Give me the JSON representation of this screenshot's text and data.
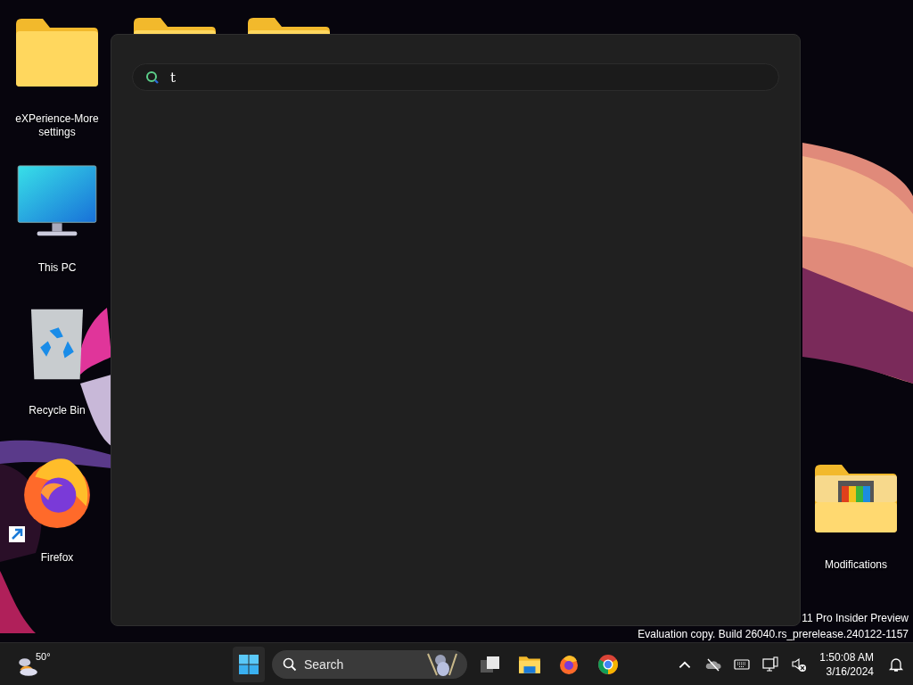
{
  "desktop": {
    "icons": [
      {
        "kind": "folder",
        "label": "eXPerience-More settings"
      },
      {
        "kind": "pc",
        "label": "This PC"
      },
      {
        "kind": "bin",
        "label": "Recycle Bin"
      },
      {
        "kind": "firefox",
        "label": "Firefox",
        "shortcut": true
      },
      {
        "kind": "folder"
      },
      {
        "kind": "folder"
      },
      {
        "kind": "folder-colors",
        "label": "Modifications"
      }
    ],
    "watermark_lines": [
      "11 Pro Insider Preview",
      "Evaluation copy. Build 26040.rs_prerelease.240122-1157"
    ]
  },
  "search_panel": {
    "query": "t"
  },
  "taskbar": {
    "weather": {
      "temperature": "50°"
    },
    "search": {
      "placeholder": "Search"
    },
    "apps": [
      {
        "kind": "task-view"
      },
      {
        "kind": "file-explorer"
      },
      {
        "kind": "firefox"
      },
      {
        "kind": "chrome"
      }
    ],
    "tray": [
      {
        "kind": "chevron"
      },
      {
        "kind": "cloud-off"
      },
      {
        "kind": "keyboard"
      },
      {
        "kind": "network"
      },
      {
        "kind": "volume-muted"
      }
    ],
    "clock": {
      "time": "1:50:08 AM",
      "date": "3/16/2024"
    }
  }
}
